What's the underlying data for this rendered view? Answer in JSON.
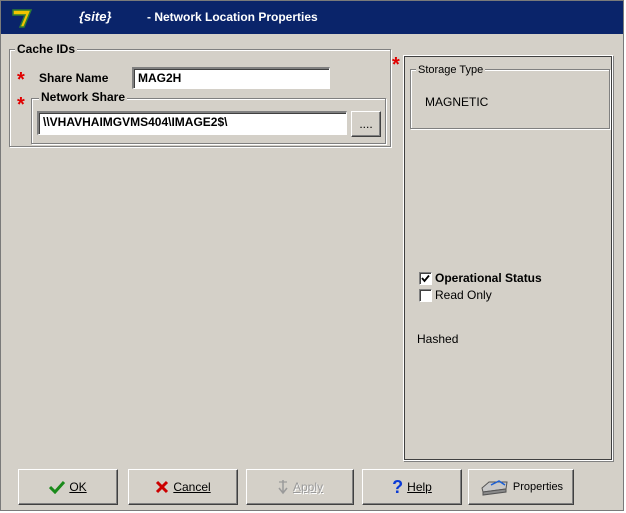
{
  "window": {
    "title_site": "{site}",
    "title": "- Network Location Properties"
  },
  "cache_ids": {
    "legend": "Cache IDs",
    "share_name_label": "Share Name",
    "share_name_value": "MAG2H",
    "network_share_legend": "Network Share",
    "network_share_value": "\\\\VHAVHAIMGVMS404\\IMAGE2$\\",
    "browse_label": "...."
  },
  "storage": {
    "legend": "Storage Type",
    "value": "MAGNETIC"
  },
  "status": {
    "operational_label": "Operational Status",
    "operational_checked": true,
    "read_only_label": "Read Only",
    "read_only_checked": false,
    "hashed_label": "Hashed"
  },
  "buttons": {
    "ok": "OK",
    "cancel": "Cancel",
    "apply": "Apply",
    "help": "Help",
    "properties": "Properties"
  },
  "colors": {
    "titlebar": "#0a246a",
    "required": "#e00000",
    "face": "#d4d0c8"
  }
}
